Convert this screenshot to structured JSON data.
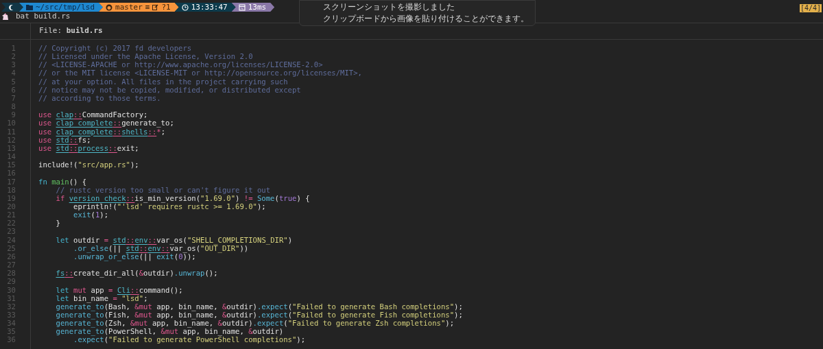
{
  "prompt": {
    "segments": [
      {
        "kind": "os",
        "color": "#123646"
      },
      {
        "kind": "path",
        "color": "#1e88d0",
        "text": "~/src/tmp/lsd"
      },
      {
        "kind": "git",
        "color": "#f7943c",
        "text": "master",
        "stash": "≡",
        "status": "?1"
      },
      {
        "kind": "time",
        "color": "#0d3b4c",
        "text": "13:33:47"
      },
      {
        "kind": "duration",
        "color": "#8a78a8",
        "text": "13ms"
      }
    ],
    "command": "bat build.rs"
  },
  "notification": {
    "lines": [
      "スクリーンショットを撮影しました",
      "クリップボードから画像を貼り付けることができます。"
    ]
  },
  "pane_badge": "[4/4]",
  "file_header": "File: **build.rs**",
  "code": [
    {
      "number": "1",
      "tokens": [
        {
          "kind": "comment",
          "text": "// Copyright (c) 2017 fd developers"
        }
      ]
    },
    {
      "number": "2",
      "tokens": [
        {
          "kind": "comment",
          "text": "// Licensed under the Apache License, Version 2.0"
        }
      ]
    },
    {
      "number": "3",
      "tokens": [
        {
          "kind": "comment",
          "text": "// <LICENSE-APACHE or http://www.apache.org/licenses/LICENSE-2.0>"
        }
      ]
    },
    {
      "number": "4",
      "tokens": [
        {
          "kind": "comment",
          "text": "// or the MIT license <LICENSE-MIT or http://opensource.org/licenses/MIT>,"
        }
      ]
    },
    {
      "number": "5",
      "tokens": [
        {
          "kind": "comment",
          "text": "// at your option. All files in the project carrying such"
        }
      ]
    },
    {
      "number": "6",
      "tokens": [
        {
          "kind": "comment",
          "text": "// notice may not be copied, modified, or distributed except"
        }
      ]
    },
    {
      "number": "7",
      "tokens": [
        {
          "kind": "comment",
          "text": "// according to those terms."
        }
      ]
    },
    {
      "number": "8"
    },
    {
      "number": "9",
      "tokens": [
        {
          "kind": "keyword",
          "text": "use"
        },
        {
          "kind": "module",
          "text": " clap"
        },
        {
          "kind": "separator",
          "text": "::"
        },
        {
          "kind": "plain",
          "text": "CommandFactory;"
        }
      ]
    },
    {
      "number": "10",
      "tokens": [
        {
          "kind": "keyword",
          "text": "use"
        },
        {
          "kind": "module",
          "text": " clap_complete"
        },
        {
          "kind": "separator",
          "text": "::"
        },
        {
          "kind": "plain",
          "text": "generate_to;"
        }
      ]
    },
    {
      "number": "11",
      "tokens": [
        {
          "kind": "keyword",
          "text": "use"
        },
        {
          "kind": "module",
          "text": " clap_complete"
        },
        {
          "kind": "separator",
          "text": "::"
        },
        {
          "kind": "module",
          "text": "shells"
        },
        {
          "kind": "separator",
          "text": "::"
        },
        {
          "kind": "operator",
          "text": "*"
        },
        {
          "kind": "plain",
          "text": ";"
        }
      ]
    },
    {
      "number": "12",
      "tokens": [
        {
          "kind": "keyword",
          "text": "use"
        },
        {
          "kind": "module",
          "text": " std"
        },
        {
          "kind": "separator",
          "text": "::"
        },
        {
          "kind": "plain",
          "text": "fs;"
        }
      ]
    },
    {
      "number": "13",
      "tokens": [
        {
          "kind": "keyword",
          "text": "use"
        },
        {
          "kind": "module",
          "text": " std"
        },
        {
          "kind": "separator",
          "text": "::"
        },
        {
          "kind": "module",
          "text": "process"
        },
        {
          "kind": "separator",
          "text": "::"
        },
        {
          "kind": "plain",
          "text": "exit;"
        }
      ]
    },
    {
      "number": "14"
    },
    {
      "number": "15",
      "tokens": [
        {
          "kind": "plain",
          "text": "include!("
        },
        {
          "kind": "string",
          "text": "\"src/app.rs\""
        },
        {
          "kind": "plain",
          "text": ");"
        }
      ]
    },
    {
      "number": "16"
    },
    {
      "number": "17",
      "tokens": [
        {
          "kind": "storage",
          "text": "fn"
        },
        {
          "kind": "definition",
          "text": " main"
        },
        {
          "kind": "plain",
          "text": "() {"
        }
      ]
    },
    {
      "number": "18",
      "tokens": [
        {
          "kind": "comment",
          "text": "    // rustc version too small or can't figure it out"
        }
      ]
    },
    {
      "number": "19",
      "tokens": [
        {
          "kind": "keyword",
          "text": "    if"
        },
        {
          "kind": "module",
          "text": " version_check"
        },
        {
          "kind": "separator",
          "text": "::"
        },
        {
          "kind": "plain",
          "text": "is_min_version("
        },
        {
          "kind": "string",
          "text": "\"1.69.0\""
        },
        {
          "kind": "plain",
          "text": ") "
        },
        {
          "kind": "operator",
          "text": "!="
        },
        {
          "kind": "call",
          "text": " Some"
        },
        {
          "kind": "plain",
          "text": "("
        },
        {
          "kind": "constant",
          "text": "true"
        },
        {
          "kind": "plain",
          "text": ") {"
        }
      ]
    },
    {
      "number": "20",
      "tokens": [
        {
          "kind": "plain",
          "text": "        eprintln!("
        },
        {
          "kind": "string",
          "text": "\"'lsd' requires rustc >= 1.69.0\""
        },
        {
          "kind": "plain",
          "text": ");"
        }
      ]
    },
    {
      "number": "21",
      "tokens": [
        {
          "kind": "call",
          "text": "        exit"
        },
        {
          "kind": "plain",
          "text": "("
        },
        {
          "kind": "constant",
          "text": "1"
        },
        {
          "kind": "plain",
          "text": ");"
        }
      ]
    },
    {
      "number": "22",
      "tokens": [
        {
          "kind": "plain",
          "text": "    }"
        }
      ]
    },
    {
      "number": "23"
    },
    {
      "number": "24",
      "tokens": [
        {
          "kind": "storage",
          "text": "    let"
        },
        {
          "kind": "plain",
          "text": " outdir "
        },
        {
          "kind": "operator",
          "text": "="
        },
        {
          "kind": "module",
          "text": " std"
        },
        {
          "kind": "separator",
          "text": "::"
        },
        {
          "kind": "module",
          "text": "env"
        },
        {
          "kind": "separator",
          "text": "::"
        },
        {
          "kind": "plain",
          "text": "var_os("
        },
        {
          "kind": "string",
          "text": "\"SHELL_COMPLETIONS_DIR\""
        },
        {
          "kind": "plain",
          "text": ")"
        }
      ]
    },
    {
      "number": "25",
      "tokens": [
        {
          "kind": "call",
          "text": "        .or_else"
        },
        {
          "kind": "plain",
          "text": "(|| "
        },
        {
          "kind": "module",
          "text": "std"
        },
        {
          "kind": "separator",
          "text": "::"
        },
        {
          "kind": "module",
          "text": "env"
        },
        {
          "kind": "separator",
          "text": "::"
        },
        {
          "kind": "plain",
          "text": "var_os("
        },
        {
          "kind": "string",
          "text": "\"OUT_DIR\""
        },
        {
          "kind": "plain",
          "text": "))"
        }
      ]
    },
    {
      "number": "26",
      "tokens": [
        {
          "kind": "call",
          "text": "        .unwrap_or_else"
        },
        {
          "kind": "plain",
          "text": "(|| "
        },
        {
          "kind": "call",
          "text": "exit"
        },
        {
          "kind": "plain",
          "text": "("
        },
        {
          "kind": "constant",
          "text": "0"
        },
        {
          "kind": "plain",
          "text": "));"
        }
      ]
    },
    {
      "number": "27"
    },
    {
      "number": "28",
      "tokens": [
        {
          "kind": "module",
          "text": "    fs"
        },
        {
          "kind": "separator",
          "text": "::"
        },
        {
          "kind": "plain",
          "text": "create_dir_all("
        },
        {
          "kind": "operator",
          "text": "&"
        },
        {
          "kind": "plain",
          "text": "outdir)"
        },
        {
          "kind": "call",
          "text": ".unwrap"
        },
        {
          "kind": "plain",
          "text": "();"
        }
      ]
    },
    {
      "number": "29"
    },
    {
      "number": "30",
      "tokens": [
        {
          "kind": "storage",
          "text": "    let"
        },
        {
          "kind": "keyword",
          "text": " mut"
        },
        {
          "kind": "plain",
          "text": " app "
        },
        {
          "kind": "operator",
          "text": "="
        },
        {
          "kind": "module",
          "text": " Cli"
        },
        {
          "kind": "separator",
          "text": "::"
        },
        {
          "kind": "plain",
          "text": "command();"
        }
      ]
    },
    {
      "number": "31",
      "tokens": [
        {
          "kind": "storage",
          "text": "    let"
        },
        {
          "kind": "plain",
          "text": " bin_name "
        },
        {
          "kind": "operator",
          "text": "="
        },
        {
          "kind": "string",
          "text": " \"lsd\""
        },
        {
          "kind": "plain",
          "text": ";"
        }
      ]
    },
    {
      "number": "32",
      "tokens": [
        {
          "kind": "call",
          "text": "    generate_to"
        },
        {
          "kind": "plain",
          "text": "(Bash, "
        },
        {
          "kind": "operator",
          "text": "&"
        },
        {
          "kind": "keyword",
          "text": "mut"
        },
        {
          "kind": "plain",
          "text": " app, bin_name, "
        },
        {
          "kind": "operator",
          "text": "&"
        },
        {
          "kind": "plain",
          "text": "outdir)"
        },
        {
          "kind": "call",
          "text": ".expect"
        },
        {
          "kind": "plain",
          "text": "("
        },
        {
          "kind": "string",
          "text": "\"Failed to generate Bash completions\""
        },
        {
          "kind": "plain",
          "text": ");"
        }
      ]
    },
    {
      "number": "33",
      "tokens": [
        {
          "kind": "call",
          "text": "    generate_to"
        },
        {
          "kind": "plain",
          "text": "(Fish, "
        },
        {
          "kind": "operator",
          "text": "&"
        },
        {
          "kind": "keyword",
          "text": "mut"
        },
        {
          "kind": "plain",
          "text": " app, bin_name, "
        },
        {
          "kind": "operator",
          "text": "&"
        },
        {
          "kind": "plain",
          "text": "outdir)"
        },
        {
          "kind": "call",
          "text": ".expect"
        },
        {
          "kind": "plain",
          "text": "("
        },
        {
          "kind": "string",
          "text": "\"Failed to generate Fish completions\""
        },
        {
          "kind": "plain",
          "text": ");"
        }
      ]
    },
    {
      "number": "34",
      "tokens": [
        {
          "kind": "call",
          "text": "    generate_to"
        },
        {
          "kind": "plain",
          "text": "(Zsh, "
        },
        {
          "kind": "operator",
          "text": "&"
        },
        {
          "kind": "keyword",
          "text": "mut"
        },
        {
          "kind": "plain",
          "text": " app, bin_name, "
        },
        {
          "kind": "operator",
          "text": "&"
        },
        {
          "kind": "plain",
          "text": "outdir)"
        },
        {
          "kind": "call",
          "text": ".expect"
        },
        {
          "kind": "plain",
          "text": "("
        },
        {
          "kind": "string",
          "text": "\"Failed to generate Zsh completions\""
        },
        {
          "kind": "plain",
          "text": ");"
        }
      ]
    },
    {
      "number": "35",
      "tokens": [
        {
          "kind": "call",
          "text": "    generate_to"
        },
        {
          "kind": "plain",
          "text": "(PowerShell, "
        },
        {
          "kind": "operator",
          "text": "&"
        },
        {
          "kind": "keyword",
          "text": "mut"
        },
        {
          "kind": "plain",
          "text": " app, bin_name, "
        },
        {
          "kind": "operator",
          "text": "&"
        },
        {
          "kind": "plain",
          "text": "outdir)"
        }
      ]
    },
    {
      "number": "36",
      "tokens": [
        {
          "kind": "call",
          "text": "        .expect"
        },
        {
          "kind": "plain",
          "text": "("
        },
        {
          "kind": "string",
          "text": "\"Failed to generate PowerShell completions\""
        },
        {
          "kind": "plain",
          "text": ");"
        }
      ]
    }
  ]
}
